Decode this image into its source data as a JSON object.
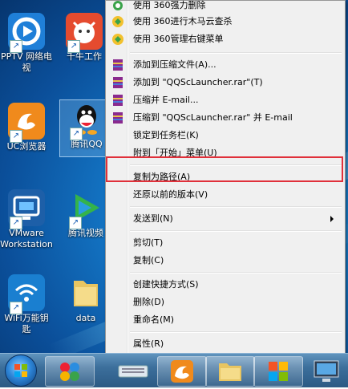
{
  "desktop": {
    "icons": [
      {
        "name": "pptv-icon",
        "label": "PPTV 网络电视",
        "color": "#1f7fd8"
      },
      {
        "name": "qianniu-icon",
        "label": "千牛工作",
        "color": "#e54b2f"
      },
      {
        "name": "uc-browser-icon",
        "label": "UC浏览器",
        "color": "#f08a1c"
      },
      {
        "name": "qq-icon",
        "label": "腾讯QQ",
        "color": "#222222"
      },
      {
        "name": "vmware-icon",
        "label": "VMware Workstation",
        "color": "#1d5fa8"
      },
      {
        "name": "tencent-video-icon",
        "label": "腾讯视频",
        "color": "#34b34a"
      },
      {
        "name": "wifi-icon",
        "label": "WiFi万能钥匙",
        "color": "#1a7fd0"
      },
      {
        "name": "folder-icon",
        "label": "data",
        "color": "#e8c561"
      }
    ]
  },
  "menu": {
    "items": [
      {
        "label": "使用 360强力删除"
      },
      {
        "label": "使用 360进行木马云查杀"
      },
      {
        "label": "使用 360管理右键菜单"
      },
      {
        "label": "添加到压缩文件(A)..."
      },
      {
        "label": "添加到 \"QQScLauncher.rar\"(T)"
      },
      {
        "label": "压缩并 E-mail..."
      },
      {
        "label": "压缩到 \"QQScLauncher.rar\" 并 E-mail"
      },
      {
        "label": "锁定到任务栏(K)"
      },
      {
        "label": "附到「开始」菜单(U)"
      },
      {
        "label": "复制为路径(A)"
      },
      {
        "label": "还原以前的版本(V)"
      },
      {
        "label": "发送到(N)"
      },
      {
        "label": "剪切(T)"
      },
      {
        "label": "复制(C)"
      },
      {
        "label": "创建快捷方式(S)"
      },
      {
        "label": "删除(D)"
      },
      {
        "label": "重命名(M)"
      },
      {
        "label": "属性(R)"
      }
    ]
  },
  "colors": {
    "highlight_box": "#e0303a",
    "menu_bg": "#f0f0f0"
  }
}
